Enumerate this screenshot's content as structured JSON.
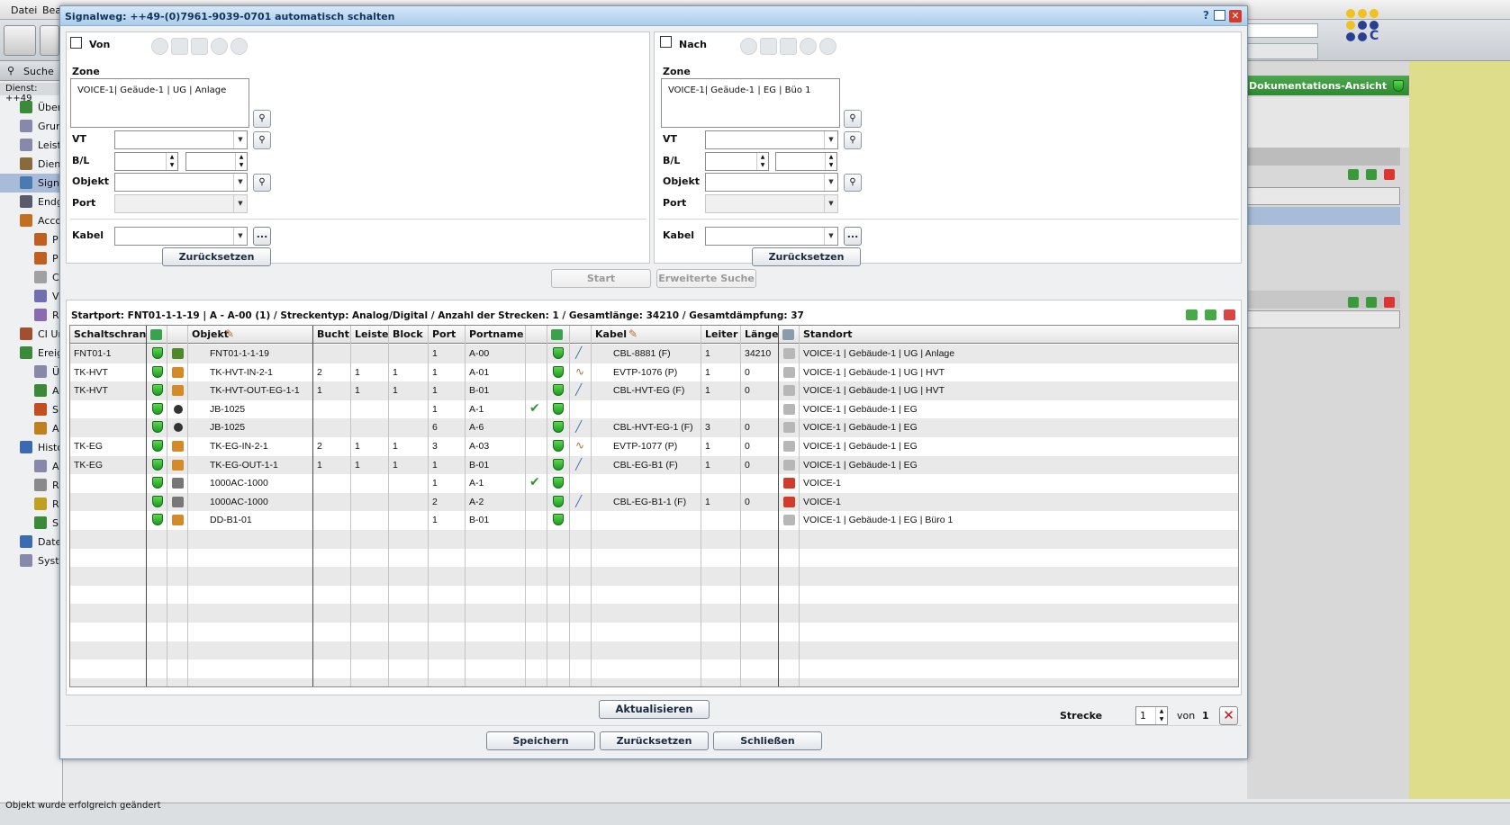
{
  "app": {
    "menu": [
      "Datei",
      "Bea"
    ],
    "search_label": "Suche",
    "dienst_label": "Dienst: ++49",
    "tree_items": [
      "Über",
      "Grur",
      "Leist",
      "Dien",
      "Sign",
      "Endg",
      "Acco",
      "P",
      "P",
      "C",
      "V",
      "R",
      "CI Ur",
      "Ereig",
      "Ü",
      "A",
      "S",
      "A",
      "Histo",
      "A",
      "R",
      "R",
      "S",
      "Date",
      "Syst"
    ],
    "right_panel_header": "Dokumentations-Ansicht",
    "status_text": "Objekt wurde erfolgreich geändert"
  },
  "dialog": {
    "title": "Signalweg: ++49-(0)7961-9039-0701 automatisch schalten",
    "von": {
      "checkbox_label": "Von",
      "zone_label": "Zone",
      "zone_value": "VOICE-1| Geäude-1 | UG | Anlage",
      "vt_label": "VT",
      "bl_label": "B/L",
      "objekt_label": "Objekt",
      "port_label": "Port",
      "kabel_label": "Kabel",
      "reset_button": "Zurücksetzen",
      "ellipsis": "..."
    },
    "nach": {
      "checkbox_label": "Nach",
      "zone_label": "Zone",
      "zone_value": "VOICE-1| Geäude-1 | EG | Büo 1",
      "vt_label": "VT",
      "bl_label": "B/L",
      "objekt_label": "Objekt",
      "port_label": "Port",
      "kabel_label": "Kabel",
      "reset_button": "Zurücksetzen",
      "ellipsis": "..."
    },
    "start_button": "Start",
    "advanced_search_button": "Erweiterte Suche",
    "summary": "Startport: FNT01-1-1-19 | A - A-00 (1)  /  Streckentyp: Analog/Digital  /  Anzahl der Strecken: 1 / Gesamtlänge: 34210  / Gesamtdämpfung: 37",
    "table": {
      "headers": [
        "Schaltschrank",
        "",
        "",
        "Objekt",
        "Bucht",
        "Leiste",
        "Block",
        "Port",
        "Portname",
        "",
        "",
        "",
        "Kabel",
        "Leiter",
        "Länge",
        "",
        "Standort"
      ],
      "rows": [
        {
          "schrank": "FNT01-1",
          "objekt": "FNT01-1-1-19",
          "bucht": "",
          "leiste": "",
          "block": "",
          "port": "1",
          "portname": "A-00",
          "check": false,
          "kabel": "CBL-8881 (F)",
          "leiter": "1",
          "laenge": "34210",
          "standort": "VOICE-1 | Gebäude-1 | UG | Anlage",
          "obj_icon": "frame-icon",
          "kabel_icon": "cable-icon",
          "loc_icon": "box-icon"
        },
        {
          "schrank": "TK-HVT",
          "objekt": "TK-HVT-IN-2-1",
          "bucht": "2",
          "leiste": "1",
          "block": "1",
          "port": "1",
          "portname": "A-01",
          "check": false,
          "kabel": "EVTP-1076 (P)",
          "leiter": "1",
          "laenge": "0",
          "standort": "VOICE-1 | Gebäude-1 | UG | HVT",
          "obj_icon": "block-icon",
          "kabel_icon": "patch-icon",
          "loc_icon": "box-icon"
        },
        {
          "schrank": "TK-HVT",
          "objekt": "TK-HVT-OUT-EG-1-1",
          "bucht": "1",
          "leiste": "1",
          "block": "1",
          "port": "1",
          "portname": "B-01",
          "check": false,
          "kabel": "CBL-HVT-EG (F)",
          "leiter": "1",
          "laenge": "0",
          "standort": "VOICE-1 | Gebäude-1 | UG | HVT",
          "obj_icon": "block-icon",
          "kabel_icon": "cable-icon",
          "loc_icon": "box-icon"
        },
        {
          "schrank": "",
          "objekt": "JB-1025",
          "bucht": "",
          "leiste": "",
          "block": "",
          "port": "1",
          "portname": "A-1",
          "check": true,
          "kabel": "",
          "leiter": "",
          "laenge": "",
          "standort": "VOICE-1 | Gebäude-1 | EG",
          "obj_icon": "junction-icon",
          "kabel_icon": "",
          "loc_icon": "box-icon"
        },
        {
          "schrank": "",
          "objekt": "JB-1025",
          "bucht": "",
          "leiste": "",
          "block": "",
          "port": "6",
          "portname": "A-6",
          "check": false,
          "kabel": "CBL-HVT-EG-1 (F)",
          "leiter": "3",
          "laenge": "0",
          "standort": "VOICE-1 | Gebäude-1 | EG",
          "obj_icon": "junction-icon",
          "kabel_icon": "cable-icon",
          "loc_icon": "box-icon"
        },
        {
          "schrank": "TK-EG",
          "objekt": "TK-EG-IN-2-1",
          "bucht": "2",
          "leiste": "1",
          "block": "1",
          "port": "3",
          "portname": "A-03",
          "check": false,
          "kabel": "EVTP-1077 (P)",
          "leiter": "1",
          "laenge": "0",
          "standort": "VOICE-1 | Gebäude-1 | EG",
          "obj_icon": "block-icon",
          "kabel_icon": "patch-icon",
          "loc_icon": "box-icon"
        },
        {
          "schrank": "TK-EG",
          "objekt": "TK-EG-OUT-1-1",
          "bucht": "1",
          "leiste": "1",
          "block": "1",
          "port": "1",
          "portname": "B-01",
          "check": false,
          "kabel": "CBL-EG-B1 (F)",
          "leiter": "1",
          "laenge": "0",
          "standort": "VOICE-1 | Gebäude-1 | EG",
          "obj_icon": "block-icon",
          "kabel_icon": "cable-icon",
          "loc_icon": "box-icon"
        },
        {
          "schrank": "",
          "objekt": "1000AC-1000",
          "bucht": "",
          "leiste": "",
          "block": "",
          "port": "1",
          "portname": "A-1",
          "check": true,
          "kabel": "",
          "leiter": "",
          "laenge": "",
          "standort": "VOICE-1",
          "obj_icon": "device-icon",
          "kabel_icon": "",
          "loc_icon": "site-icon"
        },
        {
          "schrank": "",
          "objekt": "1000AC-1000",
          "bucht": "",
          "leiste": "",
          "block": "",
          "port": "2",
          "portname": "A-2",
          "check": false,
          "kabel": "CBL-EG-B1-1 (F)",
          "leiter": "1",
          "laenge": "0",
          "standort": "VOICE-1",
          "obj_icon": "device-icon",
          "kabel_icon": "cable-icon",
          "loc_icon": "site-icon"
        },
        {
          "schrank": "",
          "objekt": "DD-B1-01",
          "bucht": "",
          "leiste": "",
          "block": "",
          "port": "1",
          "portname": "B-01",
          "check": false,
          "kabel": "",
          "leiter": "",
          "laenge": "",
          "standort": "VOICE-1 | Gebäude-1 | EG | Büro 1",
          "obj_icon": "block-icon",
          "kabel_icon": "",
          "loc_icon": "box-icon"
        }
      ]
    },
    "refresh_button": "Aktualisieren",
    "strecke_label": "Strecke",
    "strecke_value": "1",
    "von_label": "von",
    "strecke_total": "1",
    "save_button": "Speichern",
    "reset_button": "Zurücksetzen",
    "close_button": "Schließen"
  },
  "colors": {
    "title_bar": "#aacdeb",
    "green_header": "#2d8a30",
    "status_shield": "#1e9a24"
  }
}
